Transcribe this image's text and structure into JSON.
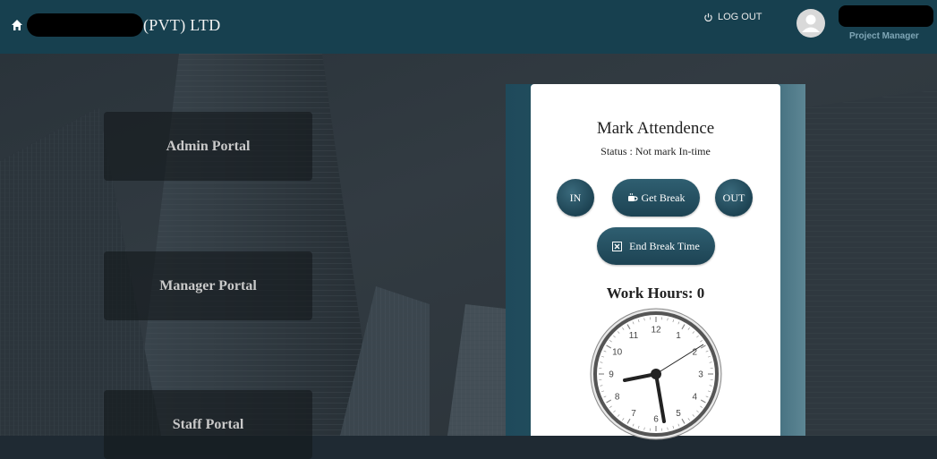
{
  "header": {
    "company_suffix": "(PVT) LTD",
    "logout_label": "LOG OUT",
    "user_role": "Project Manager"
  },
  "portals": [
    {
      "label": "Admin Portal"
    },
    {
      "label": "Manager Portal"
    },
    {
      "label": "Staff Portal"
    }
  ],
  "attendance": {
    "title": "Mark Attendence",
    "status": "Status : Not mark In-time",
    "in_label": "IN",
    "break_label": "Get Break",
    "out_label": "OUT",
    "end_break_label": "End Break Time",
    "work_hours": "Work Hours: 0"
  },
  "clock": {
    "numbers": [
      "12",
      "1",
      "2",
      "3",
      "4",
      "5",
      "6",
      "7",
      "8",
      "9",
      "10",
      "11"
    ]
  },
  "colors": {
    "header": "#17404f",
    "button": "#1d4353",
    "role_text": "#7fa6b6"
  }
}
